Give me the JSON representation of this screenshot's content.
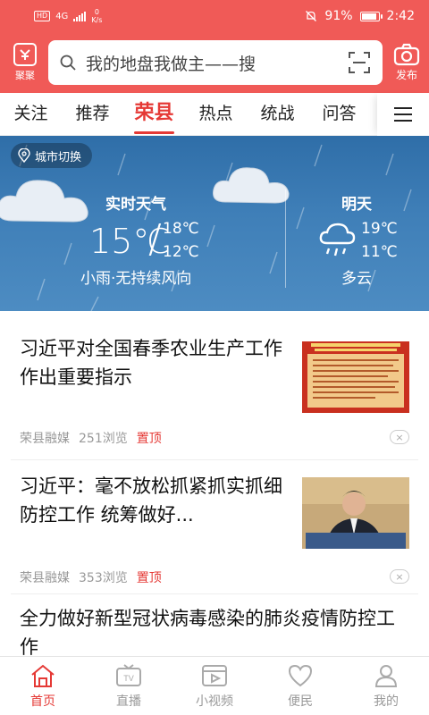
{
  "status_bar": {
    "hd": "HD",
    "network": "4G",
    "speed_value": "0",
    "speed_unit": "K/s",
    "battery": "91%",
    "time": "2:42"
  },
  "header": {
    "logo_label": "聚聚",
    "search_placeholder": "我的地盘我做主——搜",
    "publish_label": "发布"
  },
  "tabs": [
    {
      "label": "关注",
      "active": false
    },
    {
      "label": "推荐",
      "active": false
    },
    {
      "label": "荣县",
      "active": true
    },
    {
      "label": "热点",
      "active": false
    },
    {
      "label": "统战",
      "active": false
    },
    {
      "label": "问答",
      "active": false
    }
  ],
  "weather": {
    "city_switch": "城市切换",
    "now_title": "实时天气",
    "current_temp": "15℃",
    "high": "18℃",
    "low": "12℃",
    "now_desc": "小雨·无持续风向",
    "tomorrow_title": "明天",
    "tomorrow_high": "19℃",
    "tomorrow_low": "11℃",
    "tomorrow_desc": "多云"
  },
  "news": [
    {
      "title": "习近平对全国春季农业生产工作作出重要指示",
      "source": "荣县融媒",
      "views": "251浏览",
      "pin": "置顶"
    },
    {
      "title": "习近平：毫不放松抓紧抓实抓细防控工作 统筹做好...",
      "source": "荣县融媒",
      "views": "353浏览",
      "pin": "置顶"
    },
    {
      "title": "全力做好新型冠状病毒感染的肺炎疫情防控工作"
    }
  ],
  "bottom_nav": [
    {
      "label": "首页",
      "icon": "home-icon",
      "active": true
    },
    {
      "label": "直播",
      "icon": "tv-icon",
      "active": false
    },
    {
      "label": "小视频",
      "icon": "video-icon",
      "active": false
    },
    {
      "label": "便民",
      "icon": "heart-icon",
      "active": false
    },
    {
      "label": "我的",
      "icon": "user-icon",
      "active": false
    }
  ],
  "colors": {
    "brand": "#f05a57",
    "active_tab": "#e53935",
    "weather_bg": "#3f7fb8"
  }
}
